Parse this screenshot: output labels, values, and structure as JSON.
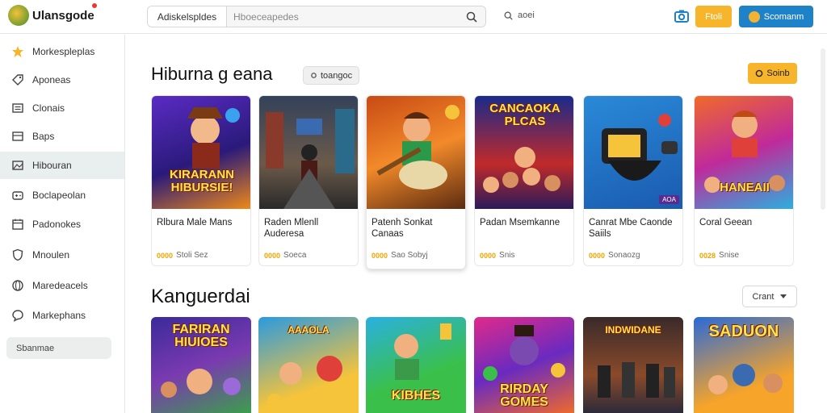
{
  "app": {
    "title": "Ulansgode"
  },
  "colors": {
    "accent_yellow": "#f6b52b",
    "accent_blue": "#1e82c8",
    "active_nav_bg": "#e9eeee"
  },
  "header": {
    "search_scope": "Adiskelspldes",
    "search_placeholder": "Hboeceapedes",
    "sub_search_label": "aoei",
    "yellow_button": "Ftoli",
    "blue_button": "Scomanm",
    "icons": [
      "search-icon",
      "camera-icon",
      "user-avatar-icon"
    ]
  },
  "sidebar": {
    "items": [
      {
        "label": "Morkespleplas",
        "icon": "star-icon"
      },
      {
        "label": "Aponeas",
        "icon": "tag-icon"
      },
      {
        "label": "Clonais",
        "icon": "list-icon"
      },
      {
        "label": "Baps",
        "icon": "grid-icon"
      },
      {
        "label": "Hibouran",
        "icon": "image-icon",
        "active": true
      },
      {
        "label": "Boclapeolan",
        "icon": "gamepad-icon"
      },
      {
        "label": "Padonokes",
        "icon": "calendar-icon"
      },
      {
        "label": "Mnoulen",
        "icon": "shield-icon"
      },
      {
        "label": "Maredeacels",
        "icon": "globe-icon"
      },
      {
        "label": "Markephans",
        "icon": "chat-icon"
      }
    ],
    "bottom_button": "Sbanmae"
  },
  "section1": {
    "title": "Hiburna g eana",
    "pill_label": "toangoc",
    "action_button": "Soinb",
    "cards": [
      {
        "title": "Rlbura Male Mans",
        "meta": "Stoli Sez",
        "stars": "0000",
        "art_text": "KIRARANN HIBURSIE!",
        "theme": "t1"
      },
      {
        "title": "Raden Mlenll Auderesa",
        "meta": "Soeca",
        "stars": "0000",
        "art_text": "",
        "theme": "t2"
      },
      {
        "title": "Patenh Sonkat Canaas",
        "meta": "Sao Sobyj",
        "stars": "0000",
        "art_text": "",
        "theme": "t3",
        "raised": true
      },
      {
        "title": "Padan Msemkanne",
        "meta": "Snis",
        "stars": "0000",
        "art_text": "CANCAOKA PLCAS",
        "theme": "t4"
      },
      {
        "title": "Canrat Mbe Caonde Saiils",
        "meta": "Sonaozg",
        "stars": "0000",
        "art_text": "",
        "theme": "t5",
        "badge": "AOA"
      },
      {
        "title": "Coral Geean",
        "meta": "Snise",
        "stars": "0028",
        "art_text": "HANEAII",
        "theme": "t6"
      }
    ]
  },
  "section2": {
    "title": "Kanguerdai",
    "sort_dropdown": "Crant",
    "cards": [
      {
        "art_text": "FARIRAN HIUIOES",
        "theme": "u1"
      },
      {
        "art_text": "AAAOLA",
        "theme": "u2"
      },
      {
        "art_text": "KIBHES",
        "theme": "u3"
      },
      {
        "art_text": "RIRDAY GOMES",
        "theme": "u4"
      },
      {
        "art_text": "INDWIDANE",
        "theme": "u5"
      },
      {
        "art_text": "SADUON",
        "theme": "u6"
      }
    ]
  }
}
